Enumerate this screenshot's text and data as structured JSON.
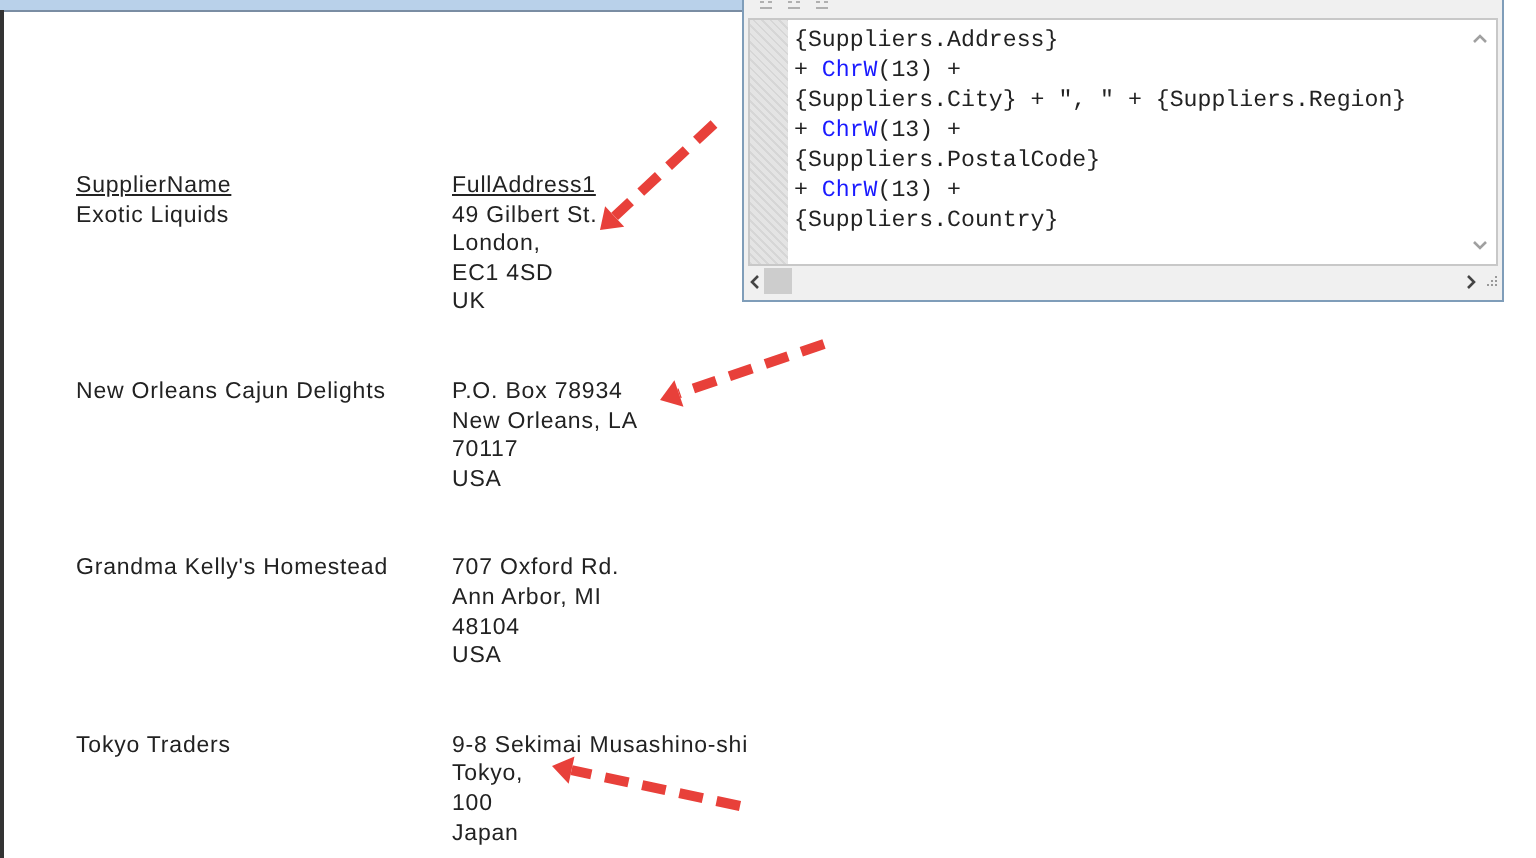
{
  "report": {
    "columns": [
      "SupplierName",
      "FullAddress1"
    ],
    "rows": [
      {
        "name": "Exotic Liquids",
        "address_lines": [
          "49 Gilbert St.",
          "London,",
          "EC1 4SD",
          "UK"
        ]
      },
      {
        "name": "New Orleans Cajun Delights",
        "address_lines": [
          "P.O. Box 78934",
          "New Orleans, LA",
          "70117",
          "USA"
        ]
      },
      {
        "name": "Grandma Kelly's Homestead",
        "address_lines": [
          "707 Oxford Rd.",
          "Ann Arbor, MI",
          "48104",
          "USA"
        ]
      },
      {
        "name": "Tokyo Traders",
        "address_lines": [
          "9-8 Sekimai Musashino-shi",
          "Tokyo,",
          "100",
          "Japan"
        ]
      }
    ]
  },
  "formula_editor": {
    "lines": [
      [
        {
          "text": "{Suppliers.Address}",
          "kind": "plain"
        }
      ],
      [
        {
          "text": "+ ",
          "kind": "plain"
        },
        {
          "text": "ChrW",
          "kind": "keyword"
        },
        {
          "text": "(13) +",
          "kind": "plain"
        }
      ],
      [
        {
          "text": "{Suppliers.City} + \", \" + {Suppliers.Region}",
          "kind": "plain"
        }
      ],
      [
        {
          "text": "+ ",
          "kind": "plain"
        },
        {
          "text": "ChrW",
          "kind": "keyword"
        },
        {
          "text": "(13) +",
          "kind": "plain"
        }
      ],
      [
        {
          "text": "{Suppliers.PostalCode}",
          "kind": "plain"
        }
      ],
      [
        {
          "text": "+ ",
          "kind": "plain"
        },
        {
          "text": "ChrW",
          "kind": "keyword"
        },
        {
          "text": "(13) +",
          "kind": "plain"
        }
      ],
      [
        {
          "text": "{Suppliers.Country}",
          "kind": "plain"
        }
      ]
    ]
  }
}
